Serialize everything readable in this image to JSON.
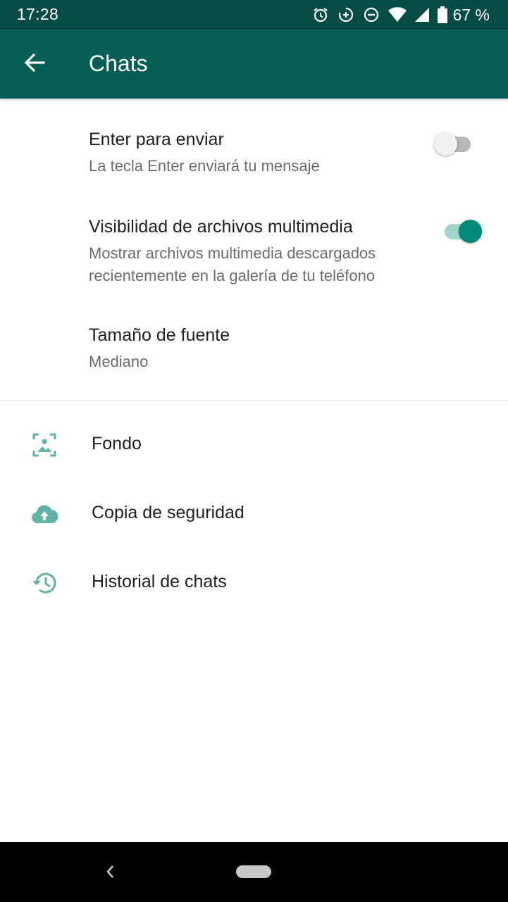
{
  "status_bar": {
    "time": "17:28",
    "battery_percent": "67 %",
    "icons": [
      "alarm-icon",
      "data-saver-icon",
      "do-not-disturb-icon",
      "wifi-icon",
      "signal-icon",
      "battery-icon"
    ]
  },
  "app_bar": {
    "title": "Chats",
    "back_icon": "arrow-back-icon"
  },
  "settings": [
    {
      "title": "Enter para enviar",
      "subtitle": "La tecla Enter enviará tu mensaje",
      "switch_on": false
    },
    {
      "title": "Visibilidad de archivos multimedia",
      "subtitle": "Mostrar archivos multimedia descargados recientemente en la galería de tu teléfono",
      "switch_on": true
    },
    {
      "title": "Tamaño de fuente",
      "subtitle": "Mediano"
    }
  ],
  "menu_items": [
    {
      "label": "Fondo",
      "icon": "wallpaper-icon"
    },
    {
      "label": "Copia de seguridad",
      "icon": "cloud-upload-icon"
    },
    {
      "label": "Historial de chats",
      "icon": "history-icon"
    }
  ],
  "colors": {
    "status_bar": "#054d44",
    "app_bar": "#075e54",
    "accent": "#00897b",
    "icon_tint": "#5fb3a6"
  },
  "nav_bar": {
    "back_icon": "nav-back-icon",
    "home_icon": "nav-home-pill"
  }
}
